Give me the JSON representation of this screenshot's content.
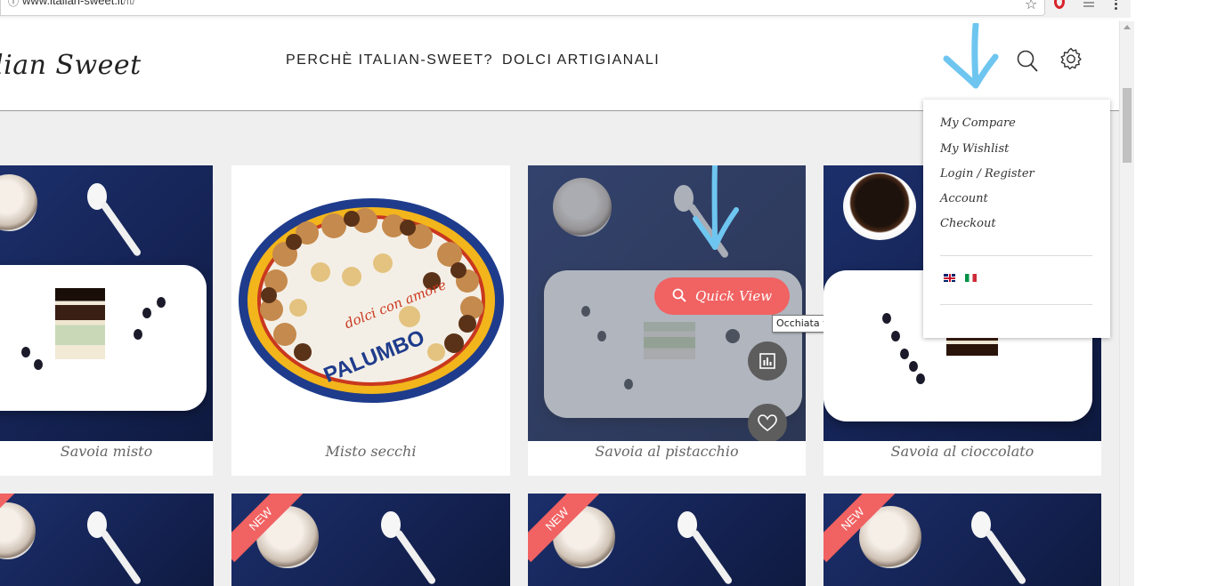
{
  "browser": {
    "url_domain": "www.italian-sweet.it",
    "url_path": "/it/"
  },
  "header": {
    "logo": "lian Sweet",
    "nav": [
      "PERCHÈ ITALIAN-SWEET?",
      "DOLCI ARTIGIANALI"
    ]
  },
  "settings_menu": {
    "items": [
      "My Compare",
      "My Wishlist",
      "Login / Register",
      "Account",
      "Checkout"
    ],
    "languages": [
      "flag-uk-icon",
      "flag-it-icon"
    ]
  },
  "products": [
    {
      "title": "Savoia misto"
    },
    {
      "title": "Misto secchi"
    },
    {
      "title": "Savoia al pistacchio"
    },
    {
      "title": "Savoia al cioccolato"
    }
  ],
  "product_image_text": {
    "plate_brand": "PALUMBO",
    "plate_script": "dolci con amore"
  },
  "quick_view": {
    "label": "Quick View",
    "tooltip": "Occhiata veloce"
  },
  "badges": {
    "new": "NEW"
  },
  "colors": {
    "accent": "#f16262",
    "annotation_arrow": "#6ec6f0",
    "product_bg": "#142252"
  }
}
